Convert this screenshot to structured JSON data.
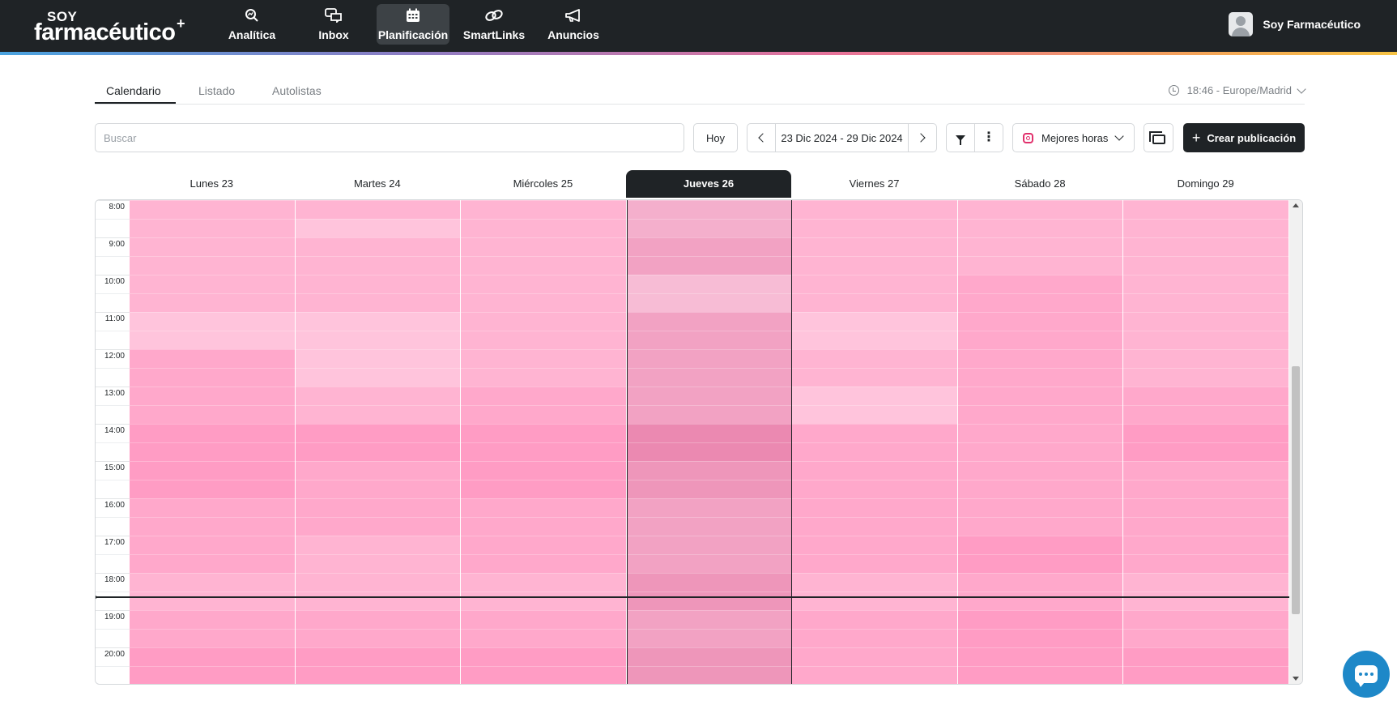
{
  "app": {
    "logo_top": "SOY",
    "logo_main": "farmacéutico",
    "nav": [
      {
        "label": "Analítica",
        "icon": "analytics-icon",
        "active": false
      },
      {
        "label": "Inbox",
        "icon": "inbox-icon",
        "active": false
      },
      {
        "label": "Planificación",
        "icon": "calendar-icon",
        "active": true
      },
      {
        "label": "SmartLinks",
        "icon": "link-icon",
        "active": false
      },
      {
        "label": "Anuncios",
        "icon": "megaphone-icon",
        "active": false
      }
    ],
    "user_name": "Soy Farmacéutico"
  },
  "tabs": {
    "items": [
      "Calendario",
      "Listado",
      "Autolistas"
    ],
    "active": "Calendario",
    "timezone": "18:46 - Europe/Madrid"
  },
  "toolbar": {
    "search_placeholder": "Buscar",
    "today_label": "Hoy",
    "range_label": "23 Dic 2024 - 29 Dic 2024",
    "best_hours_label": "Mejores horas",
    "create_label": "Crear publicación"
  },
  "calendar": {
    "days": [
      "Lunes 23",
      "Martes 24",
      "Miércoles 25",
      "Jueves 26",
      "Viernes 27",
      "Sábado 28",
      "Domingo 29"
    ],
    "today_index": 3,
    "hours": [
      "8:00",
      "9:00",
      "10:00",
      "11:00",
      "12:00",
      "13:00",
      "14:00",
      "15:00",
      "16:00",
      "17:00",
      "18:00",
      "19:00",
      "20:00"
    ],
    "current_time": "18:46",
    "heat_levels": [
      [
        2,
        2,
        2,
        2,
        2,
        2,
        1,
        1,
        3,
        3,
        3,
        3,
        4,
        4,
        4,
        4,
        3,
        3,
        3,
        3,
        2,
        2,
        3,
        3,
        4,
        4
      ],
      [
        2,
        1,
        2,
        2,
        2,
        2,
        1,
        1,
        1,
        1,
        2,
        2,
        4,
        4,
        3,
        3,
        3,
        3,
        2,
        2,
        2,
        2,
        3,
        3,
        4,
        4
      ],
      [
        2,
        2,
        2,
        2,
        2,
        2,
        2,
        2,
        2,
        2,
        3,
        3,
        4,
        4,
        4,
        4,
        3,
        3,
        3,
        3,
        2,
        2,
        3,
        3,
        4,
        4
      ],
      [
        2,
        2,
        3,
        3,
        1,
        1,
        3,
        3,
        3,
        3,
        3,
        3,
        5,
        5,
        4,
        4,
        3,
        3,
        3,
        3,
        4,
        4,
        3,
        3,
        4,
        4
      ],
      [
        2,
        2,
        2,
        2,
        2,
        2,
        1,
        1,
        2,
        2,
        1,
        1,
        3,
        3,
        3,
        3,
        3,
        3,
        3,
        3,
        2,
        2,
        3,
        3,
        3,
        3
      ],
      [
        2,
        2,
        2,
        2,
        3,
        3,
        3,
        3,
        3,
        3,
        3,
        3,
        3,
        3,
        3,
        3,
        3,
        3,
        4,
        4,
        3,
        3,
        4,
        4,
        4,
        4
      ],
      [
        2,
        2,
        2,
        2,
        2,
        2,
        2,
        2,
        2,
        2,
        3,
        3,
        4,
        4,
        3,
        3,
        3,
        3,
        3,
        3,
        2,
        2,
        3,
        3,
        4,
        4
      ]
    ],
    "heat_colors": [
      "#ffc4dc",
      "#ffb4d2",
      "#ffa8cb",
      "#ff9cc4",
      "#ff8fbb"
    ],
    "today_heat_colors": [
      "#f7bcd5",
      "#f4afcc",
      "#f2a2c3",
      "#ee96ba",
      "#eb89b1"
    ]
  }
}
